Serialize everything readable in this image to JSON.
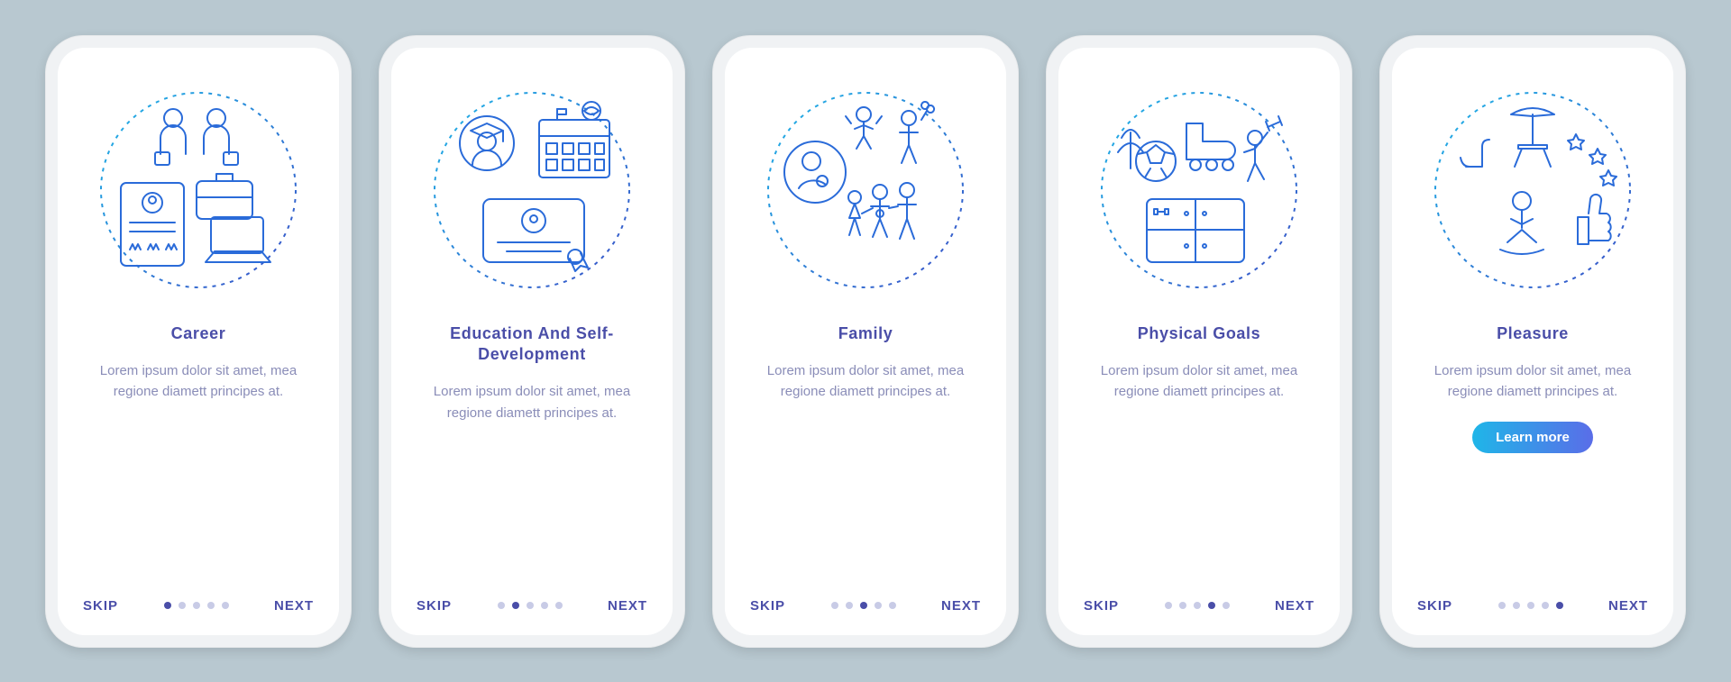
{
  "common": {
    "skip_label": "SKIP",
    "next_label": "NEXT",
    "learn_more_label": "Learn more",
    "description": "Lorem ipsum dolor sit amet, mea regione diamett principes at.",
    "dot_count": 5
  },
  "screens": [
    {
      "title": "Career",
      "active_index": 0,
      "icon": "career-icon",
      "has_cta": false
    },
    {
      "title": "Education And Self-Development",
      "active_index": 1,
      "icon": "education-icon",
      "has_cta": false
    },
    {
      "title": "Family",
      "active_index": 2,
      "icon": "family-icon",
      "has_cta": false
    },
    {
      "title": "Physical Goals",
      "active_index": 3,
      "icon": "fitness-icon",
      "has_cta": false
    },
    {
      "title": "Pleasure",
      "active_index": 4,
      "icon": "pleasure-icon",
      "has_cta": true
    }
  ],
  "colors": {
    "background": "#b8c8d0",
    "phone": "#f0f2f4",
    "title": "#4a4ea8",
    "desc": "#8a8db8",
    "dot_inactive": "#c8cbe6",
    "dot_active": "#4a4ea8",
    "cta_gradient_from": "#1fb6e8",
    "cta_gradient_to": "#5a6de8"
  }
}
